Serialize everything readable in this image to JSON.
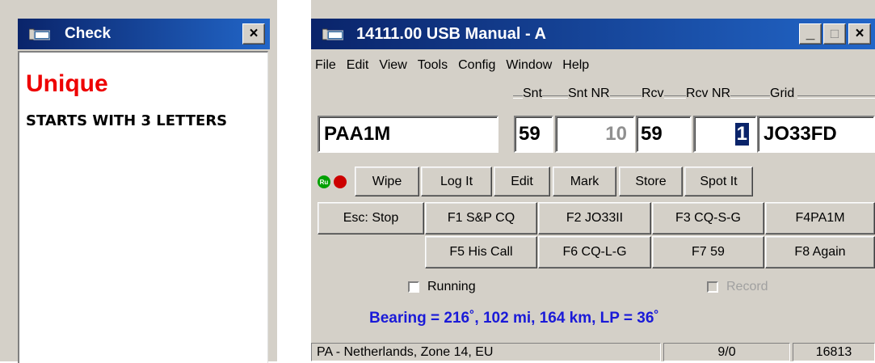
{
  "check_window": {
    "title": "Check",
    "close_label": "×",
    "status": "Unique",
    "message": "STARTS WITH 3 LETTERS"
  },
  "main_window": {
    "title": "14111.00 USB Manual - A",
    "minimize_label": "_",
    "maximize_label": "□",
    "close_label": "×",
    "menu": [
      "File",
      "Edit",
      "View",
      "Tools",
      "Config",
      "Window",
      "Help"
    ],
    "fields": {
      "labels": {
        "snt": "Snt",
        "snt_nr": "Snt NR",
        "rcv": "Rcv",
        "rcv_nr": "Rcv NR",
        "grid": "Grid"
      },
      "callsign": "PAA1M",
      "snt": "59",
      "snt_nr": "10",
      "rcv": "59",
      "rcv_nr": "1",
      "grid": "JO33FD"
    },
    "indicators": {
      "green_label": "Ru",
      "green_color": "#00a000",
      "red_color": "#cc0000"
    },
    "action_buttons": [
      "Wipe",
      "Log It",
      "Edit",
      "Mark",
      "Store",
      "Spot It"
    ],
    "function_row1": [
      "Esc: Stop",
      "F1 S&P CQ",
      "F2 JO33II",
      "F3 CQ-S-G",
      "F4PA1M"
    ],
    "function_row2": [
      "F5 His Call",
      "F6 CQ-L-G",
      "F7 59",
      "F8 Again"
    ],
    "running_label": "Running",
    "record_label": "Record",
    "bearing": "Bearing = 216˚, 102  mi, 164 km, LP = 36˚",
    "status": {
      "location": "PA - Netherlands, Zone 14, EU",
      "ratio": "9/0",
      "count": "16813"
    }
  }
}
